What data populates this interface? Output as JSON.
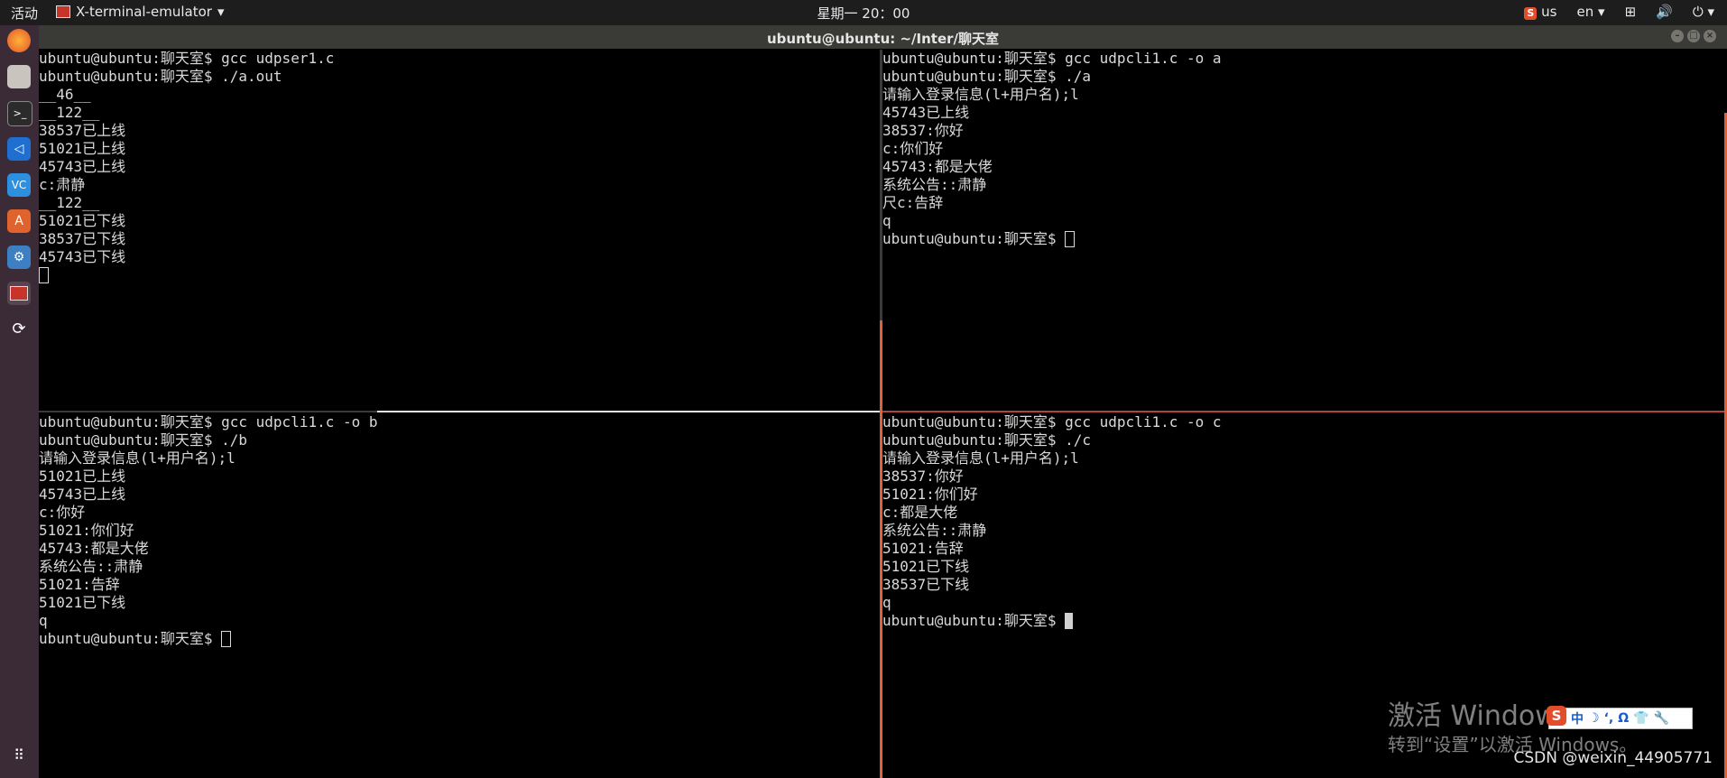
{
  "topbar": {
    "activities": "活动",
    "app_name": "X-terminal-emulator",
    "clock": "星期一 20：00",
    "input_method": "us",
    "language": "en"
  },
  "window": {
    "title": "ubuntu@ubuntu: ~/Inter/聊天室"
  },
  "dock": {
    "items": [
      "firefox-icon",
      "files-icon",
      "terminal-icon",
      "vscode-icon",
      "vc-icon",
      "software-store-icon",
      "settings-icon",
      "x-terminal-icon",
      "update-icon",
      "apps-grid-icon"
    ]
  },
  "panes": {
    "top_left": {
      "lines": [
        "ubuntu@ubuntu:聊天室$ gcc udpser1.c",
        "ubuntu@ubuntu:聊天室$ ./a.out",
        "__46__",
        "__122__",
        "38537已上线",
        "51021已上线",
        "45743已上线",
        "c:肃静",
        "__122__",
        "51021已下线",
        "38537已下线",
        "45743已下线"
      ]
    },
    "top_right": {
      "lines": [
        "ubuntu@ubuntu:聊天室$ gcc udpcli1.c -o a",
        "ubuntu@ubuntu:聊天室$ ./a",
        "请输入登录信息(l+用户名);l",
        "45743已上线",
        "38537:你好",
        "c:你们好",
        "45743:都是大佬",
        "系统公告::肃静",
        "尺c:告辞",
        "q"
      ],
      "prompt": "ubuntu@ubuntu:聊天室$ "
    },
    "bottom_left": {
      "lines": [
        "ubuntu@ubuntu:聊天室$ gcc udpcli1.c -o b",
        "ubuntu@ubuntu:聊天室$ ./b",
        "请输入登录信息(l+用户名);l",
        "51021已上线",
        "45743已上线",
        "c:你好",
        "51021:你们好",
        "45743:都是大佬",
        "系统公告::肃静",
        "51021:告辞",
        "51021已下线",
        "q"
      ],
      "prompt": "ubuntu@ubuntu:聊天室$ "
    },
    "bottom_right": {
      "lines": [
        "ubuntu@ubuntu:聊天室$ gcc udpcli1.c -o c",
        "ubuntu@ubuntu:聊天室$ ./c",
        "请输入登录信息(l+用户名);l",
        "38537:你好",
        "51021:你们好",
        "c:都是大佬",
        "系统公告::肃静",
        "51021:告辞",
        "51021已下线",
        "38537已下线",
        "q"
      ],
      "prompt": "ubuntu@ubuntu:聊天室$ "
    }
  },
  "watermark": {
    "line1": "激活 Windows",
    "line2": "转到“设置”以激活 Windows。"
  },
  "ime_toolbar": {
    "mode": "中"
  },
  "csdn_credit": "CSDN @weixin_44905771",
  "colors": {
    "topbar_bg": "#1d1d1d",
    "dock_bg": "#3b2b36",
    "divider_active": "#e0603a",
    "terminal_bg": "#000000",
    "terminal_fg": "#d9d9d9"
  }
}
